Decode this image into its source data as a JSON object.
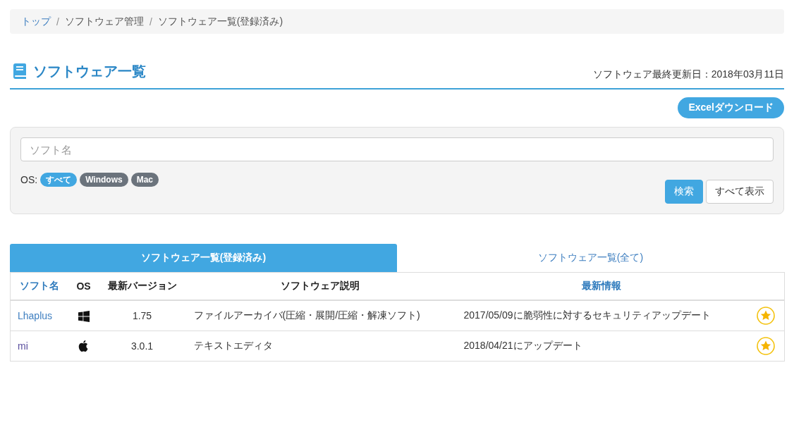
{
  "breadcrumb": {
    "separator": "/",
    "items": [
      {
        "label": "トップ",
        "link": true
      },
      {
        "label": "ソフトウェア管理",
        "link": false
      },
      {
        "label": "ソフトウェア一覧(登録済み)",
        "link": false
      }
    ]
  },
  "page_title": "ソフトウェア一覧",
  "last_updated": "ソフトウェア最終更新日：2018年03月11日",
  "excel_button": "Excelダウンロード",
  "search": {
    "placeholder": "ソフト名",
    "os_label": "OS:",
    "os_filters": [
      {
        "label": "すべて",
        "selected": true
      },
      {
        "label": "Windows",
        "selected": false
      },
      {
        "label": "Mac",
        "selected": false
      }
    ],
    "buttons": [
      {
        "label": "検索",
        "kind": "primary"
      },
      {
        "label": "すべて表示",
        "kind": "default"
      }
    ]
  },
  "tabs": [
    {
      "label": "ソフトウェア一覧(登録済み)",
      "selected": true
    },
    {
      "label": "ソフトウェア一覧(全て)",
      "selected": false
    }
  ],
  "table": {
    "columns": [
      {
        "label": "ソフト名",
        "link": true
      },
      {
        "label": "OS",
        "link": false
      },
      {
        "label": "最新バージョン",
        "link": false
      },
      {
        "label": "ソフトウェア説明",
        "link": false
      },
      {
        "label": "最新情報",
        "link": true
      }
    ],
    "rows": [
      {
        "kind": "windows",
        "name": "Lhaplus",
        "visited": false,
        "version": "1.75",
        "description": "ファイルアーカイバ(圧縮・展開/圧縮・解凍ソフト)",
        "news": "2017/05/09に脆弱性に対するセキュリティアップデート",
        "favorite": true
      },
      {
        "kind": "mac",
        "name": "mi",
        "visited": true,
        "version": "3.0.1",
        "description": "テキストエディタ",
        "news": "2018/04/21にアップデート",
        "favorite": true
      }
    ]
  }
}
